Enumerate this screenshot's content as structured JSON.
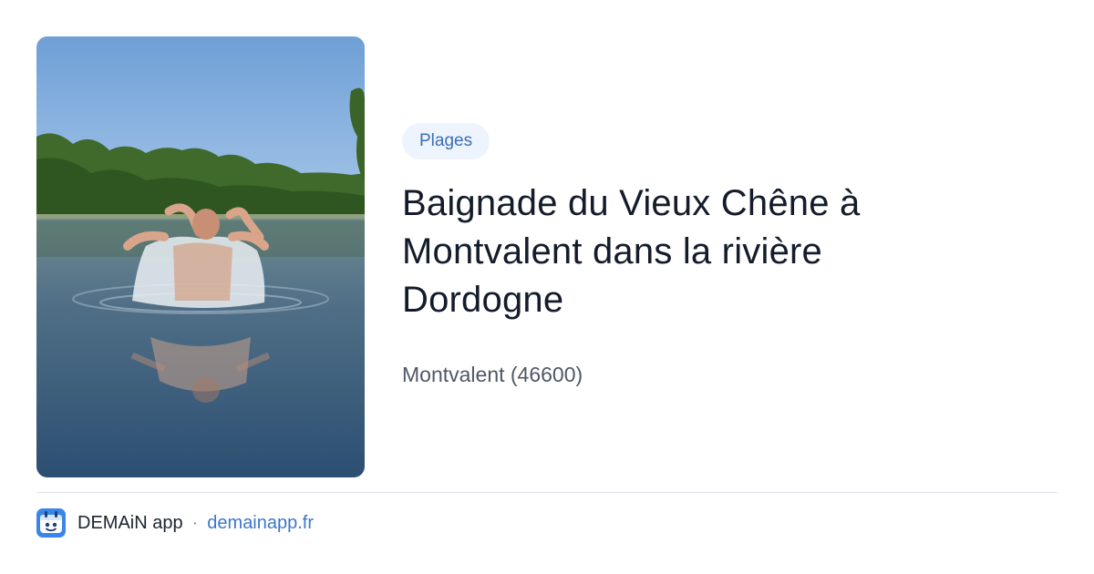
{
  "card": {
    "image_description": "woman-splashing-in-river-photo",
    "category_tag": "Plages",
    "title_lines": [
      "Baignade du Vieux Chêne à",
      "Montvalent dans la rivière",
      "Dordogne"
    ],
    "location": "Montvalent (46600)"
  },
  "footer": {
    "app_icon": "demain-app-icon",
    "app_name": "DEMAiN app",
    "separator": "·",
    "domain": "demainapp.fr"
  },
  "colors": {
    "tag_bg": "#eef4fd",
    "tag_text": "#3b6fb5",
    "title_text": "#141c2b",
    "link": "#3b77c9",
    "app_icon_blue": "#3a86e8"
  }
}
